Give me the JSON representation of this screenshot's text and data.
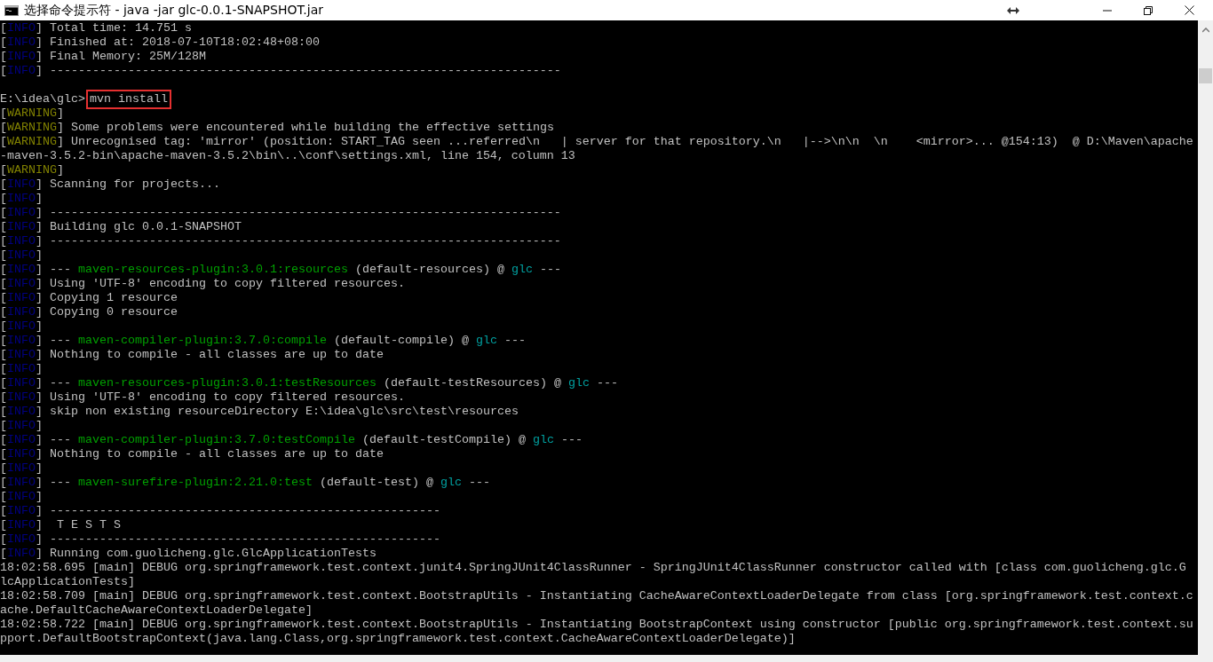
{
  "window": {
    "title": "选择命令提示符 - java  -jar glc-0.0.1-SNAPSHOT.jar"
  },
  "lines": [
    {
      "kind": "log",
      "tag": {
        "kind": "info",
        "open": "[",
        "label": "INFO",
        "close": "]"
      },
      "msg": [
        {
          "kind": "plain",
          "t": " Total time: 14.751 s"
        }
      ]
    },
    {
      "kind": "log",
      "tag": {
        "kind": "info",
        "open": "[",
        "label": "INFO",
        "close": "]"
      },
      "msg": [
        {
          "kind": "plain",
          "t": " Finished at: 2018-07-10T18:02:48+08:00"
        }
      ]
    },
    {
      "kind": "log",
      "tag": {
        "kind": "info",
        "open": "[",
        "label": "INFO",
        "close": "]"
      },
      "msg": [
        {
          "kind": "plain",
          "t": " Final Memory: 25M/128M"
        }
      ]
    },
    {
      "kind": "log",
      "tag": {
        "kind": "info",
        "open": "[",
        "label": "INFO",
        "close": "]"
      },
      "msg": [
        {
          "kind": "plain",
          "t": " ------------------------------------------------------------------------"
        }
      ]
    },
    {
      "kind": "blank"
    },
    {
      "kind": "log",
      "msg": [
        {
          "kind": "plain",
          "t": "E:\\idea\\glc>"
        },
        {
          "kind": "command",
          "t": "mvn install"
        }
      ]
    },
    {
      "kind": "log",
      "tag": {
        "kind": "warning",
        "open": "[",
        "label": "WARNING",
        "close": "]"
      }
    },
    {
      "kind": "log",
      "tag": {
        "kind": "warning",
        "open": "[",
        "label": "WARNING",
        "close": "]"
      },
      "msg": [
        {
          "kind": "plain",
          "t": " Some problems were encountered while building the effective settings"
        }
      ]
    },
    {
      "kind": "log",
      "tag": {
        "kind": "warning",
        "open": "[",
        "label": "WARNING",
        "close": "]"
      },
      "msg": [
        {
          "kind": "plain",
          "t": " Unrecognised tag: 'mirror' (position: START_TAG seen ...referred\\n   | server for that repository.\\n   |-->\\n\\n  \\n    <mirror>... @154:13)  @ D:\\Maven\\apache"
        }
      ]
    },
    {
      "kind": "log",
      "msg": [
        {
          "kind": "plain",
          "t": "-maven-3.5.2-bin\\apache-maven-3.5.2\\bin\\..\\conf\\settings.xml, line 154, column 13"
        }
      ]
    },
    {
      "kind": "log",
      "tag": {
        "kind": "warning",
        "open": "[",
        "label": "WARNING",
        "close": "]"
      }
    },
    {
      "kind": "log",
      "tag": {
        "kind": "info",
        "open": "[",
        "label": "INFO",
        "close": "]"
      },
      "msg": [
        {
          "kind": "plain",
          "t": " Scanning for projects..."
        }
      ]
    },
    {
      "kind": "log",
      "tag": {
        "kind": "info",
        "open": "[",
        "label": "INFO",
        "close": "]"
      }
    },
    {
      "kind": "log",
      "tag": {
        "kind": "info",
        "open": "[",
        "label": "INFO",
        "close": "]"
      },
      "msg": [
        {
          "kind": "plain",
          "t": " ------------------------------------------------------------------------"
        }
      ]
    },
    {
      "kind": "log",
      "tag": {
        "kind": "info",
        "open": "[",
        "label": "INFO",
        "close": "]"
      },
      "msg": [
        {
          "kind": "plain",
          "t": " Building glc 0.0.1-SNAPSHOT"
        }
      ]
    },
    {
      "kind": "log",
      "tag": {
        "kind": "info",
        "open": "[",
        "label": "INFO",
        "close": "]"
      },
      "msg": [
        {
          "kind": "plain",
          "t": " ------------------------------------------------------------------------"
        }
      ]
    },
    {
      "kind": "log",
      "tag": {
        "kind": "info",
        "open": "[",
        "label": "INFO",
        "close": "]"
      }
    },
    {
      "kind": "log",
      "tag": {
        "kind": "info",
        "open": "[",
        "label": "INFO",
        "close": "]"
      },
      "msg": [
        {
          "kind": "plain",
          "t": " --- "
        },
        {
          "kind": "plugin",
          "t": "maven-resources-plugin:3.0.1:resources"
        },
        {
          "kind": "plain",
          "t": " (default-resources) @ "
        },
        {
          "kind": "project",
          "t": "glc"
        },
        {
          "kind": "plain",
          "t": " ---"
        }
      ]
    },
    {
      "kind": "log",
      "tag": {
        "kind": "info",
        "open": "[",
        "label": "INFO",
        "close": "]"
      },
      "msg": [
        {
          "kind": "plain",
          "t": " Using 'UTF-8' encoding to copy filtered resources."
        }
      ]
    },
    {
      "kind": "log",
      "tag": {
        "kind": "info",
        "open": "[",
        "label": "INFO",
        "close": "]"
      },
      "msg": [
        {
          "kind": "plain",
          "t": " Copying 1 resource"
        }
      ]
    },
    {
      "kind": "log",
      "tag": {
        "kind": "info",
        "open": "[",
        "label": "INFO",
        "close": "]"
      },
      "msg": [
        {
          "kind": "plain",
          "t": " Copying 0 resource"
        }
      ]
    },
    {
      "kind": "log",
      "tag": {
        "kind": "info",
        "open": "[",
        "label": "INFO",
        "close": "]"
      }
    },
    {
      "kind": "log",
      "tag": {
        "kind": "info",
        "open": "[",
        "label": "INFO",
        "close": "]"
      },
      "msg": [
        {
          "kind": "plain",
          "t": " --- "
        },
        {
          "kind": "plugin",
          "t": "maven-compiler-plugin:3.7.0:compile"
        },
        {
          "kind": "plain",
          "t": " (default-compile) @ "
        },
        {
          "kind": "project",
          "t": "glc"
        },
        {
          "kind": "plain",
          "t": " ---"
        }
      ]
    },
    {
      "kind": "log",
      "tag": {
        "kind": "info",
        "open": "[",
        "label": "INFO",
        "close": "]"
      },
      "msg": [
        {
          "kind": "plain",
          "t": " Nothing to compile - all classes are up to date"
        }
      ]
    },
    {
      "kind": "log",
      "tag": {
        "kind": "info",
        "open": "[",
        "label": "INFO",
        "close": "]"
      }
    },
    {
      "kind": "log",
      "tag": {
        "kind": "info",
        "open": "[",
        "label": "INFO",
        "close": "]"
      },
      "msg": [
        {
          "kind": "plain",
          "t": " --- "
        },
        {
          "kind": "plugin",
          "t": "maven-resources-plugin:3.0.1:testResources"
        },
        {
          "kind": "plain",
          "t": " (default-testResources) @ "
        },
        {
          "kind": "project",
          "t": "glc"
        },
        {
          "kind": "plain",
          "t": " ---"
        }
      ]
    },
    {
      "kind": "log",
      "tag": {
        "kind": "info",
        "open": "[",
        "label": "INFO",
        "close": "]"
      },
      "msg": [
        {
          "kind": "plain",
          "t": " Using 'UTF-8' encoding to copy filtered resources."
        }
      ]
    },
    {
      "kind": "log",
      "tag": {
        "kind": "info",
        "open": "[",
        "label": "INFO",
        "close": "]"
      },
      "msg": [
        {
          "kind": "plain",
          "t": " skip non existing resourceDirectory E:\\idea\\glc\\src\\test\\resources"
        }
      ]
    },
    {
      "kind": "log",
      "tag": {
        "kind": "info",
        "open": "[",
        "label": "INFO",
        "close": "]"
      }
    },
    {
      "kind": "log",
      "tag": {
        "kind": "info",
        "open": "[",
        "label": "INFO",
        "close": "]"
      },
      "msg": [
        {
          "kind": "plain",
          "t": " --- "
        },
        {
          "kind": "plugin",
          "t": "maven-compiler-plugin:3.7.0:testCompile"
        },
        {
          "kind": "plain",
          "t": " (default-testCompile) @ "
        },
        {
          "kind": "project",
          "t": "glc"
        },
        {
          "kind": "plain",
          "t": " ---"
        }
      ]
    },
    {
      "kind": "log",
      "tag": {
        "kind": "info",
        "open": "[",
        "label": "INFO",
        "close": "]"
      },
      "msg": [
        {
          "kind": "plain",
          "t": " Nothing to compile - all classes are up to date"
        }
      ]
    },
    {
      "kind": "log",
      "tag": {
        "kind": "info",
        "open": "[",
        "label": "INFO",
        "close": "]"
      }
    },
    {
      "kind": "log",
      "tag": {
        "kind": "info",
        "open": "[",
        "label": "INFO",
        "close": "]"
      },
      "msg": [
        {
          "kind": "plain",
          "t": " --- "
        },
        {
          "kind": "plugin",
          "t": "maven-surefire-plugin:2.21.0:test"
        },
        {
          "kind": "plain",
          "t": " (default-test) @ "
        },
        {
          "kind": "project",
          "t": "glc"
        },
        {
          "kind": "plain",
          "t": " ---"
        }
      ]
    },
    {
      "kind": "log",
      "tag": {
        "kind": "info",
        "open": "[",
        "label": "INFO",
        "close": "]"
      }
    },
    {
      "kind": "log",
      "tag": {
        "kind": "info",
        "open": "[",
        "label": "INFO",
        "close": "]"
      },
      "msg": [
        {
          "kind": "plain",
          "t": " -------------------------------------------------------"
        }
      ]
    },
    {
      "kind": "log",
      "tag": {
        "kind": "info",
        "open": "[",
        "label": "INFO",
        "close": "]"
      },
      "msg": [
        {
          "kind": "plain",
          "t": "  T E S T S"
        }
      ]
    },
    {
      "kind": "log",
      "tag": {
        "kind": "info",
        "open": "[",
        "label": "INFO",
        "close": "]"
      },
      "msg": [
        {
          "kind": "plain",
          "t": " -------------------------------------------------------"
        }
      ]
    },
    {
      "kind": "log",
      "tag": {
        "kind": "info",
        "open": "[",
        "label": "INFO",
        "close": "]"
      },
      "msg": [
        {
          "kind": "plain",
          "t": " Running com.guolicheng.glc.GlcApplicationTests"
        }
      ]
    },
    {
      "kind": "log",
      "msg": [
        {
          "kind": "plain",
          "t": "18:02:58.695 [main] DEBUG org.springframework.test.context.junit4.SpringJUnit4ClassRunner - SpringJUnit4ClassRunner constructor called with [class com.guolicheng.glc.G"
        }
      ]
    },
    {
      "kind": "log",
      "msg": [
        {
          "kind": "plain",
          "t": "lcApplicationTests]"
        }
      ]
    },
    {
      "kind": "log",
      "msg": [
        {
          "kind": "plain",
          "t": "18:02:58.709 [main] DEBUG org.springframework.test.context.BootstrapUtils - Instantiating CacheAwareContextLoaderDelegate from class [org.springframework.test.context.c"
        }
      ]
    },
    {
      "kind": "log",
      "msg": [
        {
          "kind": "plain",
          "t": "ache.DefaultCacheAwareContextLoaderDelegate]"
        }
      ]
    },
    {
      "kind": "log",
      "msg": [
        {
          "kind": "plain",
          "t": "18:02:58.722 [main] DEBUG org.springframework.test.context.BootstrapUtils - Instantiating BootstrapContext using constructor [public org.springframework.test.context.su"
        }
      ]
    },
    {
      "kind": "log",
      "msg": [
        {
          "kind": "plain",
          "t": "pport.DefaultBootstrapContext(java.lang.Class,org.springframework.test.context.CacheAwareContextLoaderDelegate)]"
        }
      ]
    }
  ]
}
